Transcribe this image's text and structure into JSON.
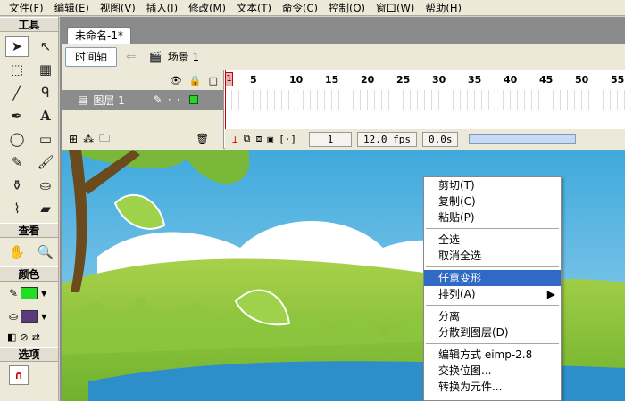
{
  "menu": [
    "文件(F)",
    "编辑(E)",
    "视图(V)",
    "插入(I)",
    "修改(M)",
    "文本(T)",
    "命令(C)",
    "控制(O)",
    "窗口(W)",
    "帮助(H)"
  ],
  "tools": {
    "title": "工具",
    "view_title": "查看",
    "colors_title": "颜色",
    "options_title": "选项"
  },
  "colors": {
    "stroke": "#22dd22",
    "fill": "#5a3a7a",
    "highlight": "#316ac5"
  },
  "doc": {
    "tab": "未命名-1*",
    "timeline_button": "时间轴",
    "scene": "场景 1"
  },
  "timeline": {
    "layer": "图层 1",
    "ruler": [
      "1",
      "5",
      "10",
      "15",
      "20",
      "25",
      "30",
      "35",
      "40",
      "45",
      "50",
      "55"
    ],
    "frame": "1",
    "fps": "12.0 fps",
    "time": "0.0s"
  },
  "context_menu": {
    "groups": [
      [
        {
          "label": "剪切(T)"
        },
        {
          "label": "复制(C)"
        },
        {
          "label": "粘贴(P)"
        }
      ],
      [
        {
          "label": "全选"
        },
        {
          "label": "取消全选"
        }
      ],
      [
        {
          "label": "任意变形",
          "highlight": true
        },
        {
          "label": "排列(A)",
          "sub": "▶"
        }
      ],
      [
        {
          "label": "分离"
        },
        {
          "label": "分散到图层(D)"
        }
      ],
      [
        {
          "label": "编辑方式 eimp-2.8"
        },
        {
          "label": "交换位图..."
        },
        {
          "label": "转换为元件..."
        }
      ]
    ]
  }
}
